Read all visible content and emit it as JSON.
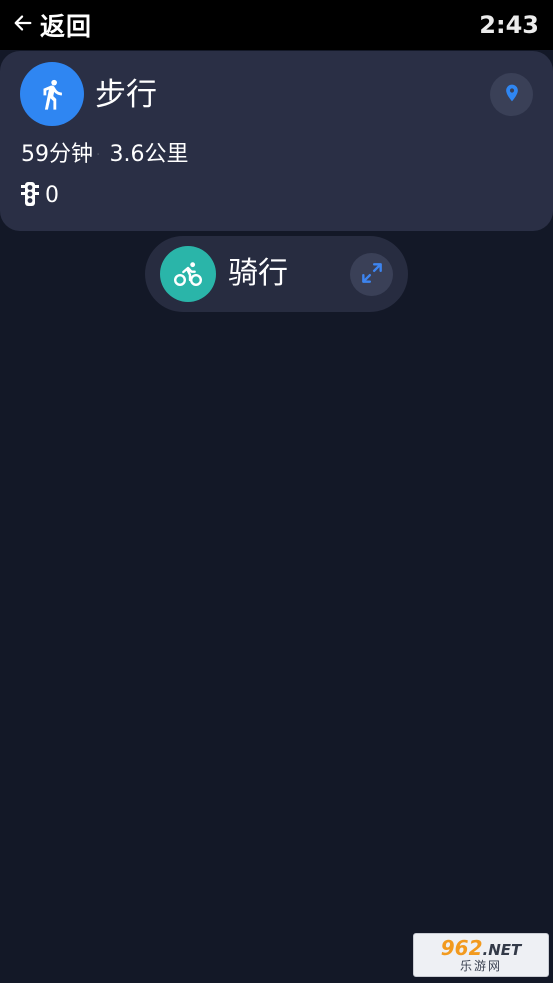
{
  "status_bar": {
    "back_label": "返回",
    "time": "2:43"
  },
  "walk": {
    "title": "步行",
    "duration": "59分钟",
    "distance": "3.6公里",
    "traffic_lights": "0",
    "accent_color": "#2f86f2"
  },
  "ride": {
    "title": "骑行",
    "accent_color": "#2ab5a9"
  },
  "watermark": {
    "brand_number": "962",
    "brand_suffix": ".NET",
    "brand_name": "乐游网"
  },
  "icons": [
    "back-arrow-icon",
    "walking-person-icon",
    "location-pin-icon",
    "traffic-light-icon",
    "bicycle-icon",
    "expand-icon"
  ]
}
